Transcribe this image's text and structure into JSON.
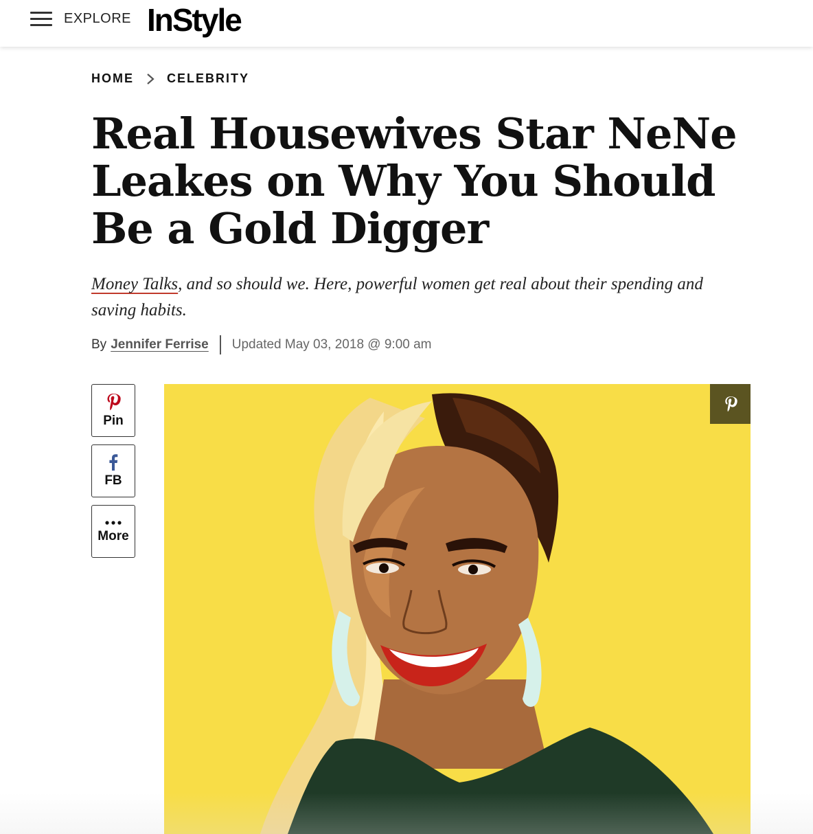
{
  "header": {
    "explore_label": "EXPLORE",
    "logo_text": "InStyle"
  },
  "breadcrumb": {
    "items": [
      "HOME",
      "CELEBRITY"
    ]
  },
  "article": {
    "title": "Real Housewives Star NeNe Leakes on Why You Should Be a Gold Digger",
    "dek_link": "Money Talks",
    "dek_rest": ", and so should we. Here, powerful women get real about their spending and saving habits.",
    "byline_prefix": "By",
    "author": "Jennifer Ferrise",
    "updated": "Updated May 03, 2018 @ 9:00 am"
  },
  "share": {
    "pin_label": "Pin",
    "fb_label": "FB",
    "more_label": "More"
  },
  "colors": {
    "pinterest_red": "#bd081c",
    "facebook_blue": "#3b5998",
    "hero_bg": "#f8dd47",
    "hero_pin_bg": "#5b5421",
    "dek_underline": "#c0392b"
  },
  "icons": {
    "menu": "hamburger-icon",
    "chevron": "chevron-right-icon",
    "pin": "pinterest-icon",
    "fb": "facebook-icon",
    "more": "more-dots-icon"
  }
}
